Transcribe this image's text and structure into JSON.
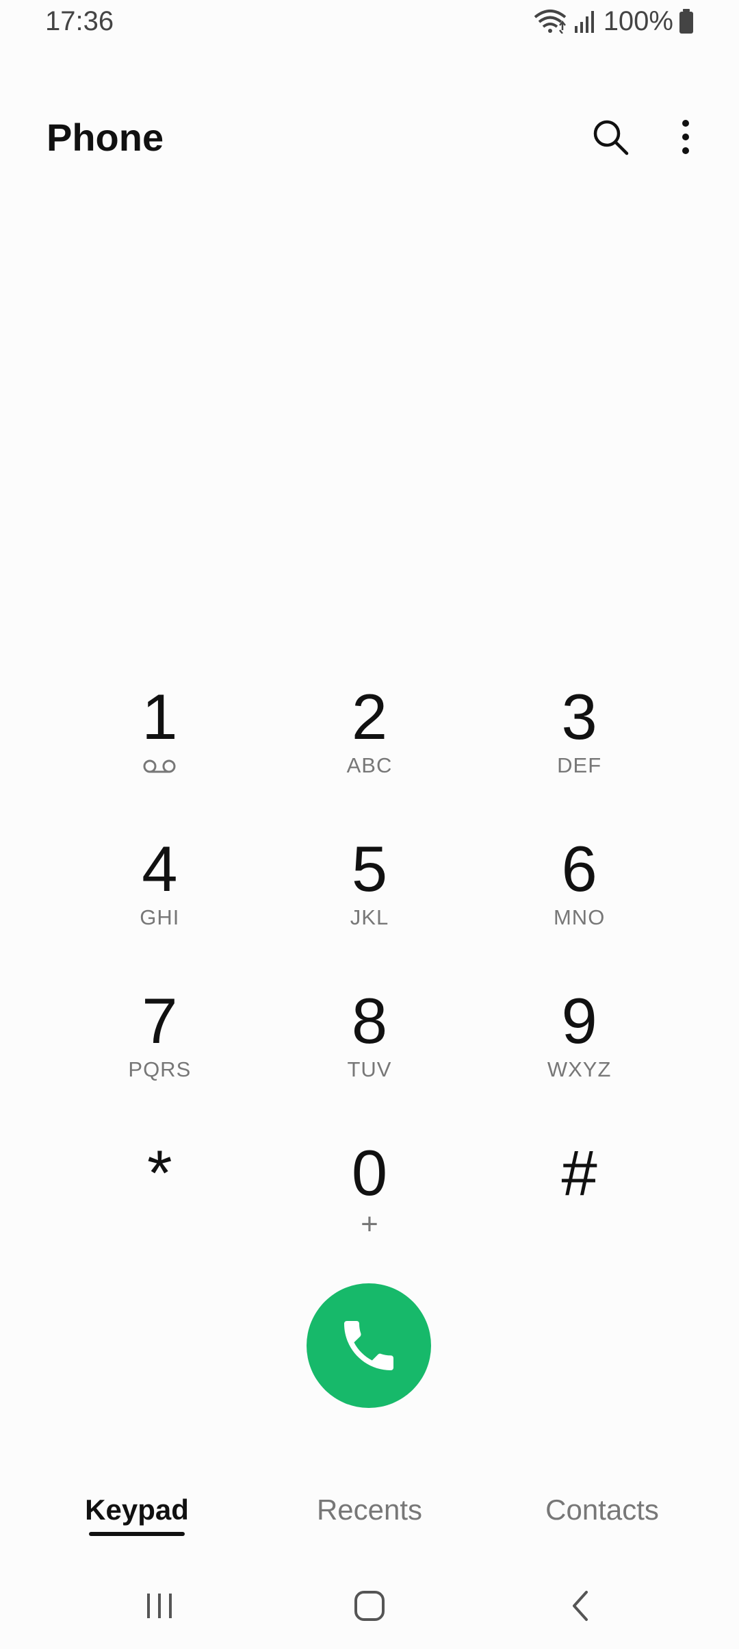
{
  "status_bar": {
    "time": "17:36",
    "battery": "100%",
    "icons": [
      "wifi-icon",
      "signal-icon",
      "battery-icon"
    ]
  },
  "app_bar": {
    "title": "Phone",
    "actions": [
      "search-icon",
      "more-options-icon"
    ]
  },
  "keypad": {
    "keys": [
      {
        "digit": "1",
        "letters": "",
        "sub_icon": "voicemail-icon"
      },
      {
        "digit": "2",
        "letters": "ABC"
      },
      {
        "digit": "3",
        "letters": "DEF"
      },
      {
        "digit": "4",
        "letters": "GHI"
      },
      {
        "digit": "5",
        "letters": "JKL"
      },
      {
        "digit": "6",
        "letters": "MNO"
      },
      {
        "digit": "7",
        "letters": "PQRS"
      },
      {
        "digit": "8",
        "letters": "TUV"
      },
      {
        "digit": "9",
        "letters": "WXYZ"
      },
      {
        "digit": "*",
        "letters": ""
      },
      {
        "digit": "0",
        "letters": "+"
      },
      {
        "digit": "#",
        "letters": ""
      }
    ]
  },
  "call_button": {
    "icon": "phone-call-icon",
    "color": "#17b96a"
  },
  "tabs": [
    {
      "label": "Keypad",
      "active": true
    },
    {
      "label": "Recents",
      "active": false
    },
    {
      "label": "Contacts",
      "active": false
    }
  ],
  "nav_bar": [
    "recent-apps-icon",
    "home-icon",
    "back-icon"
  ]
}
